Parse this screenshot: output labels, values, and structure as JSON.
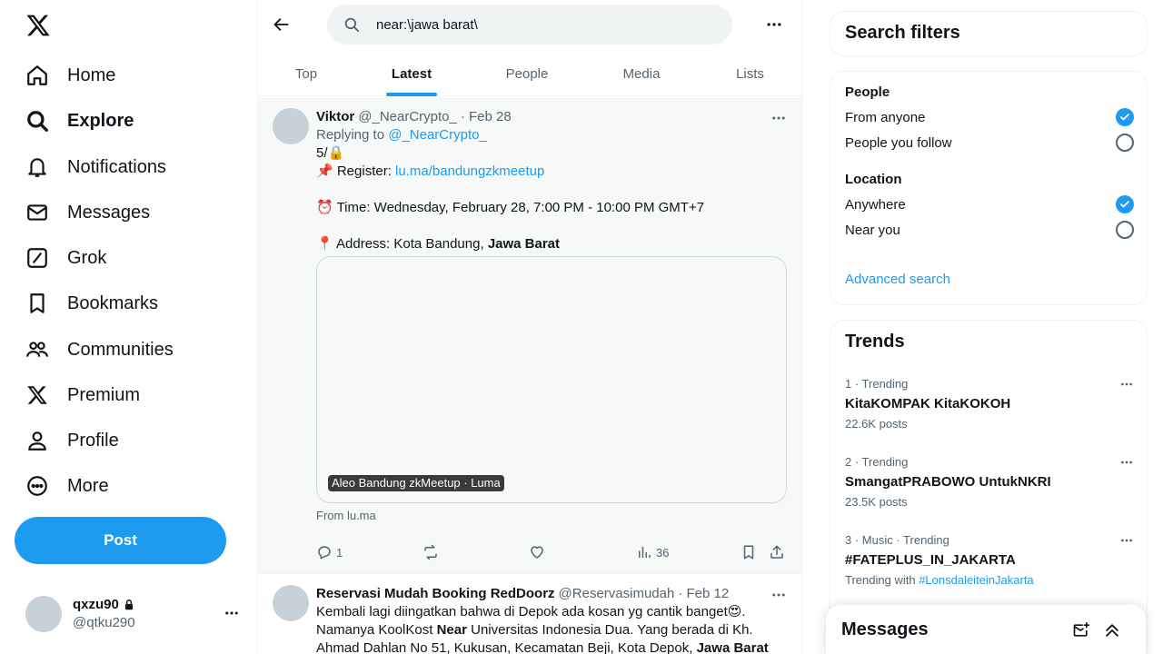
{
  "nav": {
    "items": [
      {
        "label": "Home",
        "icon": "home-icon"
      },
      {
        "label": "Explore",
        "icon": "search-icon"
      },
      {
        "label": "Notifications",
        "icon": "bell-icon"
      },
      {
        "label": "Messages",
        "icon": "envelope-icon"
      },
      {
        "label": "Grok",
        "icon": "grok-icon"
      },
      {
        "label": "Bookmarks",
        "icon": "bookmark-icon"
      },
      {
        "label": "Communities",
        "icon": "people-icon"
      },
      {
        "label": "Premium",
        "icon": "x-logo-icon"
      },
      {
        "label": "Profile",
        "icon": "person-icon"
      },
      {
        "label": "More",
        "icon": "more-circle-icon"
      }
    ],
    "active": "Explore",
    "post_label": "Post"
  },
  "account": {
    "name": "qxzu90",
    "handle": "@qtku290"
  },
  "search": {
    "query": "near:\\jawa barat\\"
  },
  "tabs": [
    "Top",
    "Latest",
    "People",
    "Media",
    "Lists"
  ],
  "active_tab": "Latest",
  "tweets": [
    {
      "name": "Viktor",
      "handle": "@_NearCrypto_",
      "date": "· Feb 28",
      "replying_label": "Replying to",
      "replying_to": "@_NearCrypto_",
      "line1": "5/🔒",
      "register_label": "📌 Register:",
      "register_link": "lu.ma/bandungzkmeetup",
      "time_line": "⏰ Time: Wednesday, February 28, 7:00 PM - 10:00 PM GMT+7",
      "address_label": "📍 Address: Kota Bandung,",
      "address_bold": "Jawa Barat",
      "card_label": "Aleo Bandung zkMeetup · Luma",
      "card_from": "From lu.ma",
      "replies": "1",
      "views": "36"
    },
    {
      "name": "Reservasi Mudah Booking RedDoorz",
      "handle": "@Reservasimudah",
      "date": "· Feb 12",
      "line1": "Kembali lagi diingatkan bahwa di Depok ada kosan yg cantik banget😍.",
      "line2_a": "Namanya KoolKost ",
      "line2_bold": "Near",
      "line2_b": " Universitas Indonesia Dua. Yang berada di Kh.",
      "line3_a": "Ahmad Dahlan No 51, Kukusan, Kecamatan Beji, Kota Depok, ",
      "line3_bold": "Jawa Barat"
    }
  ],
  "filters": {
    "title": "Search filters",
    "people_heading": "People",
    "people_options": [
      "From anyone",
      "People you follow"
    ],
    "location_heading": "Location",
    "location_options": [
      "Anywhere",
      "Near you"
    ],
    "advanced": "Advanced search"
  },
  "trends": {
    "title": "Trends",
    "items": [
      {
        "context": "1 · Trending",
        "name": "KitaKOMPAK KitaKOKOH",
        "count": "22.6K posts"
      },
      {
        "context": "2 · Trending",
        "name": "SmangatPRABOWO UntukNKRI",
        "count": "23.5K posts"
      },
      {
        "context": "3 · Music · Trending",
        "name": "#FATEPLUS_IN_JAKARTA",
        "with_label": "Trending with",
        "with_tag": "#LonsdaleiteinJakarta"
      }
    ]
  },
  "messages_drawer": {
    "title": "Messages"
  },
  "colors": {
    "accent": "#1d9bf0",
    "text": "#0f1419",
    "muted": "#536471",
    "border": "#eff3f4"
  }
}
